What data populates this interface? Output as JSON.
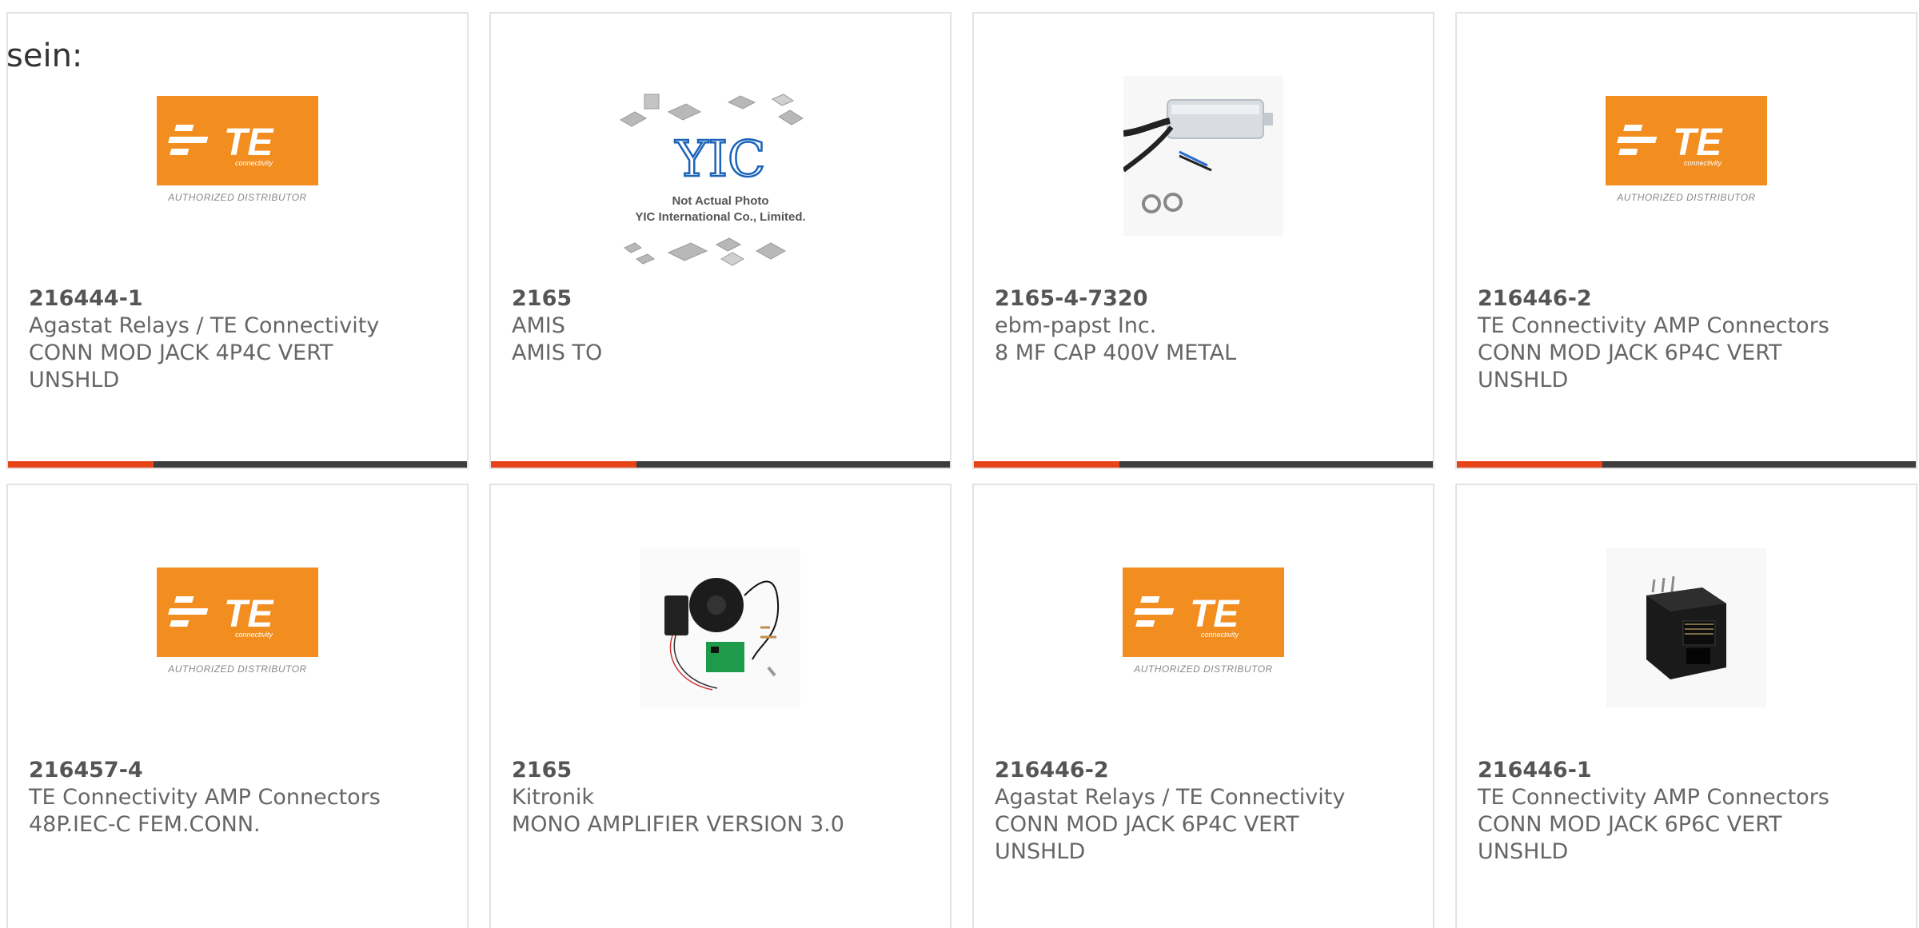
{
  "intro_text": "sein:",
  "colors": {
    "accent": "#e8441a",
    "bar": "#3d3d3d",
    "te_orange": "#f28e20",
    "card_border": "#e3e3e3"
  },
  "products": [
    {
      "part_number": "216444-1",
      "manufacturer": "Agastat Relays / TE Connectivity",
      "description": "CONN MOD JACK 4P4C VERT UNSHLD",
      "image": "te-logo",
      "logo_caption": "AUTHORIZED DISTRIBUTOR"
    },
    {
      "part_number": "2165",
      "manufacturer": "AMIS",
      "description": "AMIS TO",
      "image": "yic-placeholder",
      "placeholder_line1": "Not Actual Photo",
      "placeholder_line2": "YIC International Co., Limited."
    },
    {
      "part_number": "2165-4-7320",
      "manufacturer": "ebm-papst Inc.",
      "description": "8 MF CAP 400V METAL",
      "image": "capacitor-photo"
    },
    {
      "part_number": "216446-2",
      "manufacturer": "TE Connectivity AMP Connectors",
      "description": "CONN MOD JACK 6P4C VERT UNSHLD",
      "image": "te-logo",
      "logo_caption": "AUTHORIZED DISTRIBUTOR"
    },
    {
      "part_number": "216457-4",
      "manufacturer": "TE Connectivity AMP Connectors",
      "description": "48P.IEC-C FEM.CONN.",
      "image": "te-logo",
      "logo_caption": "AUTHORIZED DISTRIBUTOR"
    },
    {
      "part_number": "2165",
      "manufacturer": "Kitronik",
      "description": "MONO AMPLIFIER VERSION 3.0",
      "image": "amplifier-kit-photo"
    },
    {
      "part_number": "216446-2",
      "manufacturer": "Agastat Relays / TE Connectivity",
      "description": "CONN MOD JACK 6P4C VERT UNSHLD",
      "image": "te-logo",
      "logo_caption": "AUTHORIZED DISTRIBUTOR"
    },
    {
      "part_number": "216446-1",
      "manufacturer": "TE Connectivity AMP Connectors",
      "description": "CONN MOD JACK 6P6C VERT UNSHLD",
      "image": "modular-jack-photo"
    }
  ]
}
